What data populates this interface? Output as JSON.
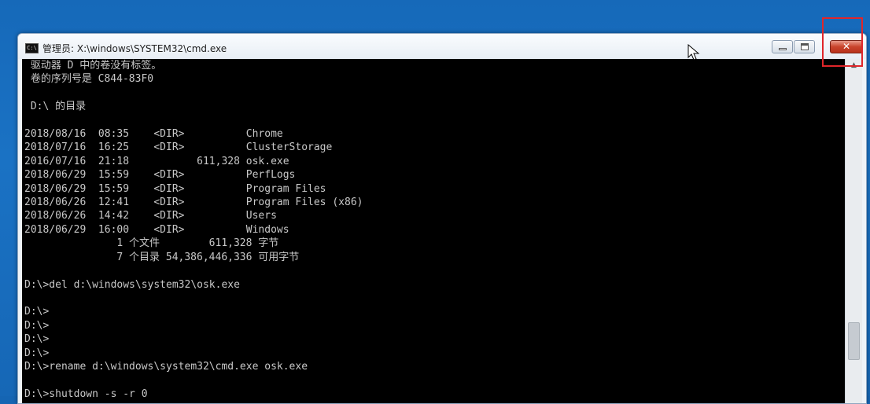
{
  "window": {
    "app_icon_text": "C:\\",
    "title": "管理员: X:\\windows\\SYSTEM32\\cmd.exe",
    "close_symbol": "✕"
  },
  "console": {
    "lines": [
      " 驱动器 D 中的卷没有标签。",
      " 卷的序列号是 C844-83F0",
      "",
      " D:\\ 的目录",
      "",
      "2018/08/16  08:35    <DIR>          Chrome",
      "2018/07/16  16:25    <DIR>          ClusterStorage",
      "2016/07/16  21:18           611,328 osk.exe",
      "2018/06/29  15:59    <DIR>          PerfLogs",
      "2018/06/29  15:59    <DIR>          Program Files",
      "2018/06/26  12:41    <DIR>          Program Files (x86)",
      "2018/06/26  14:42    <DIR>          Users",
      "2018/06/29  16:00    <DIR>          Windows",
      "               1 个文件        611,328 字节",
      "               7 个目录 54,386,446,336 可用字节",
      "",
      "D:\\>del d:\\windows\\system32\\osk.exe",
      "",
      "D:\\>",
      "D:\\>",
      "D:\\>",
      "D:\\>",
      "D:\\>rename d:\\windows\\system32\\cmd.exe osk.exe",
      "",
      "D:\\>shutdown -s -r 0"
    ]
  },
  "icons": {
    "app": "cmd-app-icon",
    "minimize": "minimize-icon",
    "maximize": "maximize-icon",
    "close": "close-icon",
    "cursor": "mouse-pointer-icon"
  },
  "colors": {
    "desktop": "#1669b9",
    "console_bg": "#000000",
    "console_fg": "#c8c8c8",
    "close_button": "#c9442c",
    "highlight": "#e0262a"
  }
}
